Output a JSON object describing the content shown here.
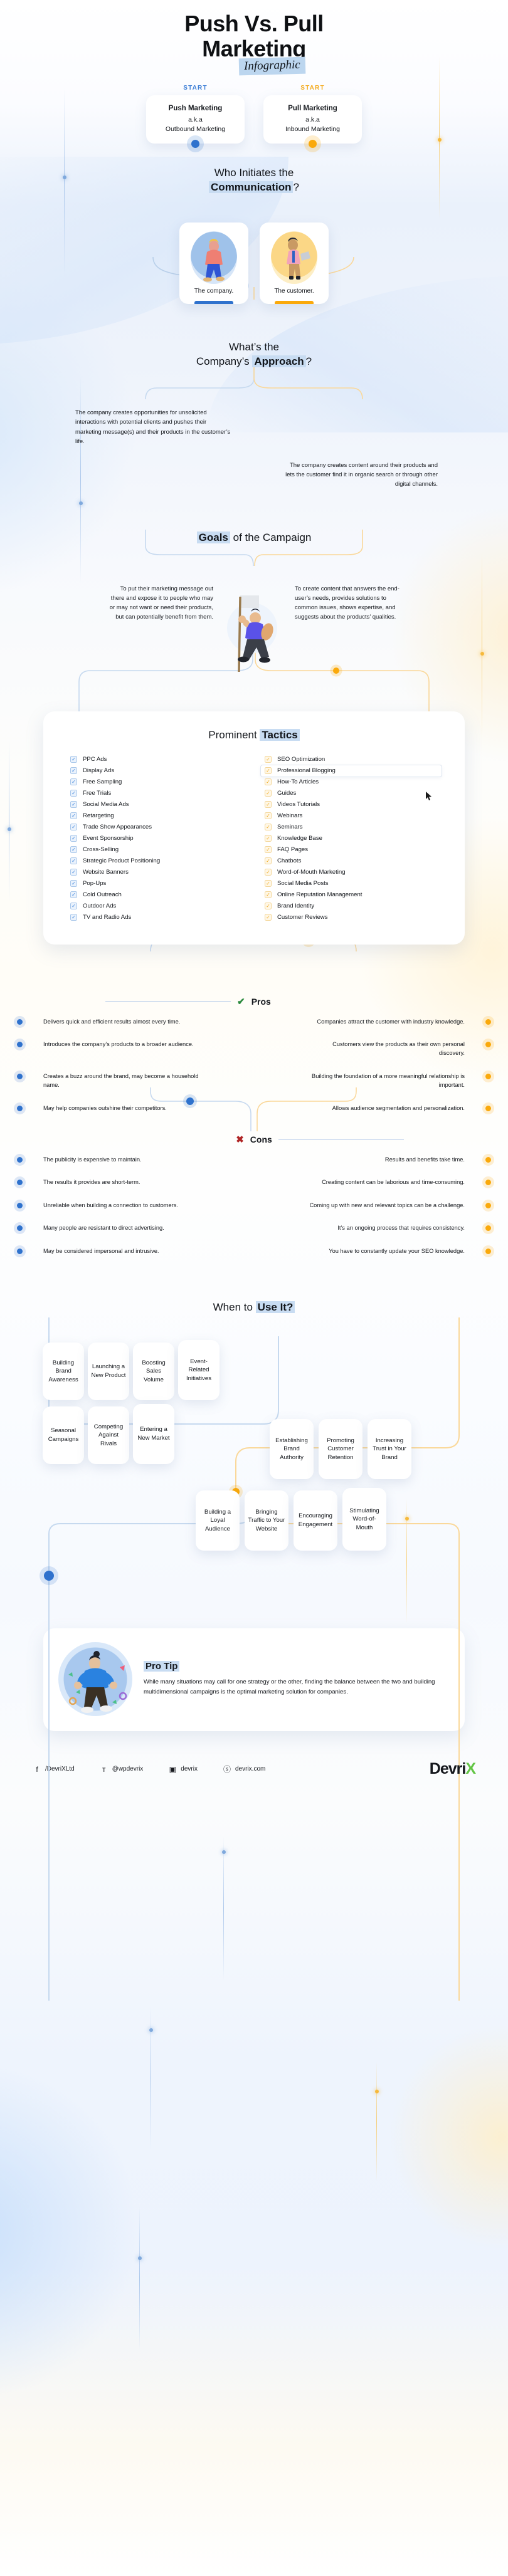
{
  "hero": {
    "title_line1": "Push Vs. Pull",
    "title_line2": "Marketing",
    "badge": "Infographic"
  },
  "start": {
    "left": {
      "label": "START",
      "title": "Push Marketing",
      "aka": "a.k.a",
      "subtitle": "Outbound Marketing",
      "color": "#3f7fd6"
    },
    "right": {
      "label": "START",
      "title": "Pull Marketing",
      "aka": "a.k.a",
      "subtitle": "Inbound Marketing",
      "color": "#f4ac21"
    }
  },
  "communication": {
    "heading_line1": "Who Initiates the",
    "heading_highlight": "Communication",
    "heading_suffix": "?",
    "left_caption": "The company.",
    "right_caption": "The customer."
  },
  "approach": {
    "heading_line1": "What’s the",
    "heading_prefix": "Company’s ",
    "heading_highlight": "Approach",
    "heading_suffix": "?",
    "push_text": "The company creates opportunities for unsolicited interactions with potential clients and pushes their marketing message(s) and their products in the customer’s life.",
    "pull_text": "The company creates content around their products and lets the customer find it in organic search or through other digital channels."
  },
  "goals": {
    "heading_highlight": "Goals",
    "heading_suffix": " of the Campaign",
    "push_text": "To put their marketing message out there and expose it to people who may or may not want or need their products, but can potentially benefit from them.",
    "pull_text": "To create content that answers the end-user’s needs, provides solutions to common issues, shows expertise, and suggests about the products’ qualities."
  },
  "tactics": {
    "heading_prefix": "Prominent ",
    "heading_highlight": "Tactics",
    "push_items": [
      "PPC Ads",
      "Display Ads",
      "Free Sampling",
      "Free Trials",
      "Social Media Ads",
      "Retargeting",
      "Trade Show Appearances",
      "Event Sponsorship",
      "Cross-Selling",
      "Strategic Product Positioning",
      "Website Banners",
      "Pop-Ups",
      "Cold Outreach",
      "Outdoor Ads",
      "TV and Radio Ads"
    ],
    "pull_items": [
      "SEO Optimization",
      "Professional Blogging",
      "How-To Articles",
      "Guides",
      "Videos Tutorials",
      "Webinars",
      "Seminars",
      "Knowledge Base",
      "FAQ Pages",
      "Chatbots",
      "Word-of-Mouth Marketing",
      "Social Media Posts",
      "Online Reputation Management",
      "Brand Identity",
      "Customer Reviews"
    ],
    "hovered_item": "Professional Blogging",
    "check_glyph": "✓"
  },
  "pros": {
    "title": "Pros",
    "mark": "✔",
    "rows": [
      {
        "push": "Delivers quick and efficient results almost every time.",
        "pull": "Companies attract the customer with industry knowledge."
      },
      {
        "push": "Introduces the company’s products to a broader audience.",
        "pull": "Customers view the products as their own personal discovery."
      },
      {
        "push": "Creates a buzz around the brand, may become a household name.",
        "pull": "Building the foundation of a more meaningful relationship is important."
      },
      {
        "push": "May help companies outshine their competitors.",
        "pull": "Allows audience segmentation and personalization."
      }
    ]
  },
  "cons": {
    "title": "Cons",
    "mark": "✖",
    "rows": [
      {
        "push": "The publicity is expensive to maintain.",
        "pull": "Results and benefits take time."
      },
      {
        "push": "The results it provides are short-term.",
        "pull": "Creating content can be laborious and time-consuming."
      },
      {
        "push": "Unreliable when building a connection to customers.",
        "pull": "Coming up with new and relevant topics can be a challenge."
      },
      {
        "push": "Many people are resistant to direct advertising.",
        "pull": "It’s an ongoing process that requires consistency."
      },
      {
        "push": "May be considered impersonal and intrusive.",
        "pull": "You have to constantly update your SEO knowledge."
      }
    ]
  },
  "when": {
    "heading_prefix": "When to ",
    "heading_highlight": "Use It?",
    "push_chips_row1": [
      "Building Brand Awareness",
      "Launching a New Product",
      "Boosting Sales Volume",
      "Event-Related Initiatives"
    ],
    "push_chips_row2": [
      "Seasonal Campaigns",
      "Competing Against Rivals",
      "Entering a New Market"
    ],
    "pull_chips_row1": [
      "Establishing Brand Authority",
      "Promoting Customer Retention",
      "Increasing Trust in Your Brand"
    ],
    "pull_chips_row2": [
      "Building a Loyal Audience",
      "Bringing Traffic to Your Website",
      "Encouraging Engagement",
      "Stimulating Word-of-Mouth"
    ]
  },
  "protip": {
    "title": "Pro Tip",
    "text": "While many situations may call for one strategy or the other, finding the balance between the two and building multidimensional campaigns is the optimal marketing solution for companies."
  },
  "footer": {
    "socials": [
      {
        "icon": "facebook-icon",
        "glyph": "f",
        "label": "/DevriXLtd"
      },
      {
        "icon": "twitter-icon",
        "glyph": "ᴛ",
        "label": "@wpdevrix"
      },
      {
        "icon": "instagram-icon",
        "glyph": "▣",
        "label": "devrix"
      },
      {
        "icon": "globe-icon",
        "glyph": "ⓢ",
        "label": "devrix.com"
      }
    ],
    "brand_prefix": "Devri",
    "brand_accent": "X",
    "accent_color": "#62c544"
  },
  "colors": {
    "push_blue": "#2f72cd",
    "pull_gold": "#faa90b",
    "highlight": "#c8dcf2",
    "pros_green": "#2b8a3e",
    "cons_red": "#b02525"
  }
}
